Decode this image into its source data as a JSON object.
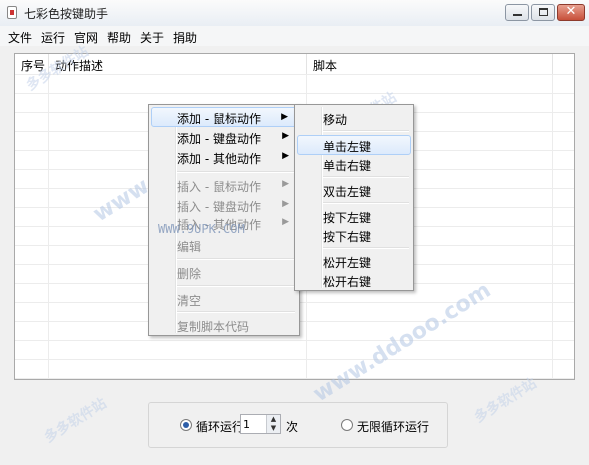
{
  "window": {
    "title": "七彩色按键助手",
    "buttons": {
      "minimize": "—",
      "maximize": "□",
      "close": "✕"
    }
  },
  "menubar": {
    "items": [
      "文件",
      "运行",
      "官网",
      "帮助",
      "关于",
      "捐助"
    ]
  },
  "list": {
    "columns": [
      "序号",
      "动作描述",
      "脚本"
    ]
  },
  "context_menu": {
    "items": [
      {
        "label": "添加 - 鼠标动作",
        "submenu": true,
        "enabled": true,
        "highlighted": true
      },
      {
        "label": "添加 - 键盘动作",
        "submenu": true,
        "enabled": true
      },
      {
        "label": "添加 - 其他动作",
        "submenu": true,
        "enabled": true
      },
      {
        "label": "插入 - 鼠标动作",
        "submenu": true,
        "enabled": false
      },
      {
        "label": "插入 - 键盘动作",
        "submenu": true,
        "enabled": false
      },
      {
        "label": "插入 - 其他动作",
        "submenu": true,
        "enabled": false
      },
      {
        "label": "编辑",
        "enabled": false
      },
      {
        "label": "删除",
        "enabled": false
      },
      {
        "label": "清空",
        "enabled": false
      },
      {
        "label": "复制脚本代码",
        "enabled": false
      }
    ],
    "arrow_glyph": "▶"
  },
  "submenu": {
    "items": [
      {
        "label": "移动"
      },
      {
        "label": "单击左键",
        "highlighted": true
      },
      {
        "label": "单击右键"
      },
      {
        "label": "双击左键"
      },
      {
        "label": "按下左键"
      },
      {
        "label": "按下右键"
      },
      {
        "label": "松开左键"
      },
      {
        "label": "松开右键"
      }
    ]
  },
  "loop": {
    "loop_label": "循环运行",
    "count": "1",
    "unit": "次",
    "infinite_label": "无限循环运行",
    "spin_up": "▲",
    "spin_down": "▼"
  },
  "watermarks": {
    "main": "www.ddooo.com",
    "cn": "多多软件站",
    "flat": "WWW.9UPK.COM"
  },
  "colors": {
    "highlight_border": "#aecff7",
    "radio_fill": "#2d5ea8"
  }
}
